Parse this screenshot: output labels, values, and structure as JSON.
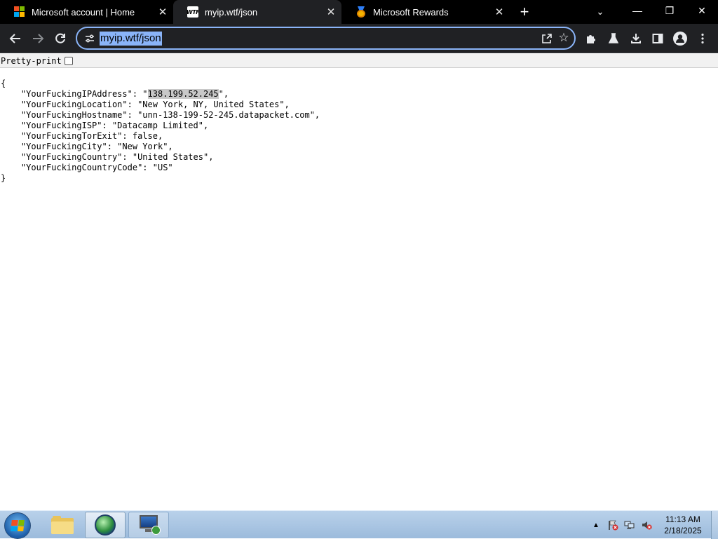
{
  "browser": {
    "tabs": [
      {
        "title": "Microsoft account | Home",
        "icon": "microsoft-logo-icon",
        "active": false
      },
      {
        "title": "myip.wtf/json",
        "icon": "wtf-favicon-icon",
        "active": true
      },
      {
        "title": "Microsoft Rewards",
        "icon": "rewards-medal-icon",
        "active": false
      }
    ],
    "tab_close_glyph": "✕",
    "new_tab_glyph": "+",
    "tab_search_glyph": "⌄",
    "window_controls": {
      "minimize": "—",
      "restore": "❐",
      "close": "✕"
    },
    "address": "myip.wtf/json",
    "colors": {
      "tabstrip": "#000000",
      "toolbar": "#202124",
      "omnibox_border": "#8ab4f8",
      "selection": "#8ab4f8"
    }
  },
  "page": {
    "pretty_print_label": "Pretty-print",
    "pretty_print_checked": false,
    "json_lines": [
      "{",
      "    \"YourFuckingIPAddress\": \"",
      "    \"YourFuckingLocation\": \"New York, NY, United States\",",
      "    \"YourFuckingHostname\": \"unn-138-199-52-245.datapacket.com\",",
      "    \"YourFuckingISP\": \"Datacamp Limited\",",
      "    \"YourFuckingTorExit\": false,",
      "    \"YourFuckingCity\": \"New York\",",
      "    \"YourFuckingCountry\": \"United States\",",
      "    \"YourFuckingCountryCode\": \"US\"",
      "}"
    ],
    "ip_value": "138.199.52.245",
    "ip_line_suffix": "\","
  },
  "taskbar": {
    "clock_time": "11:13 AM",
    "clock_date": "2/18/2025",
    "tray_arrow": "▲"
  }
}
